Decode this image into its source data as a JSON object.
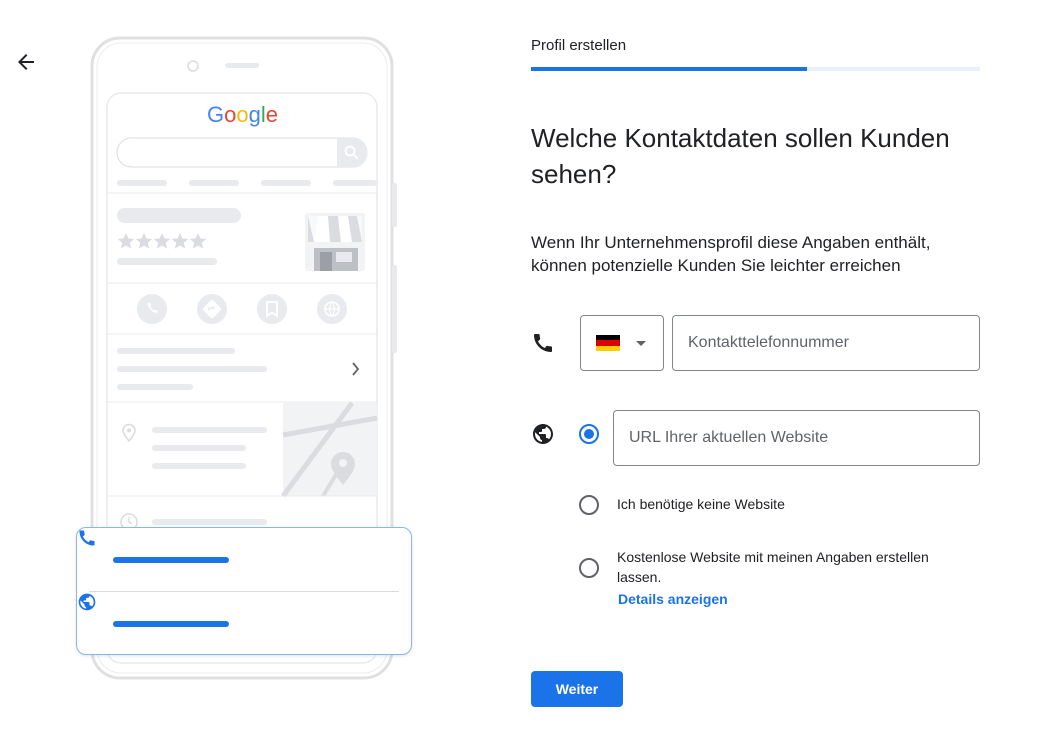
{
  "header": {
    "back_icon": "arrow-back-icon"
  },
  "illustration": {
    "search_brand": "Google",
    "rating_stars": 5,
    "colors": {
      "google_blue": "#4285F4",
      "google_red": "#EA4335",
      "google_yellow": "#FBBC05",
      "google_green": "#34A853"
    },
    "popup_icons": [
      "phone-icon",
      "globe-icon"
    ]
  },
  "form": {
    "step_label": "Profil erstellen",
    "progress_fraction": 0.614,
    "title": "Welche Kontaktdaten sollen Kunden sehen?",
    "subtitle": "Wenn Ihr Unternehmensprofil diese Angaben enthält, können potenzielle Kunden Sie leichter erreichen",
    "phone": {
      "icon": "phone-icon",
      "country_flag": "germany-flag",
      "placeholder": "Kontakttelefonnummer",
      "value": ""
    },
    "website": {
      "icon": "globe-icon",
      "selected_option": 0,
      "url_placeholder": "URL Ihrer aktuellen Website",
      "url_value": "",
      "option_no_website": "Ich benötige keine Website",
      "option_free_website": "Kostenlose Website mit meinen Angaben erstellen lassen.",
      "details_link": "Details anzeigen"
    },
    "next_button": "Weiter"
  },
  "colors": {
    "accent": "#1A73E8",
    "text": "#202124",
    "secondary_text": "#5F6368",
    "border": "#80868B",
    "progress_track": "#E8F0FE"
  }
}
